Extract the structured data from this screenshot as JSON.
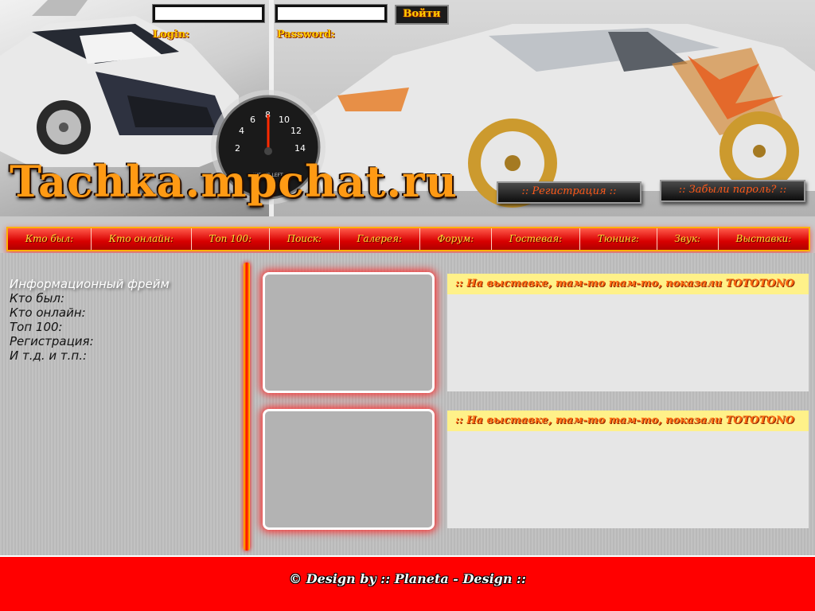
{
  "header": {
    "site_title": "Tachka.mpchat.ru",
    "login_label": "Login:",
    "password_label": "Password:",
    "login_value": "",
    "password_value": "",
    "submit_label": "Войти",
    "register_label": ":: Регистрация ::",
    "forgot_label": ":: Забыли пароль? ::",
    "gauge": {
      "ticks": [
        "2",
        "4",
        "6",
        "8",
        "10",
        "12",
        "14"
      ],
      "caption": "WEEKS LEFT"
    }
  },
  "nav": {
    "items": [
      "Кто был:",
      "Кто онлайн:",
      "Топ 100:",
      "Поиск:",
      "Галерея:",
      "Форум:",
      "Гостевая:",
      "Тюнинг:",
      "Звук:",
      "Выставки:"
    ]
  },
  "info_frame": {
    "title": "Информационный фрейм",
    "lines": [
      "Кто был:",
      "Кто онлайн:",
      "Топ 100:",
      "Регистрация:",
      "И т.д. и т.п.:"
    ]
  },
  "news": [
    {
      "headline": ":: На выставке, там-то там-то, показали ТОТОТОNO"
    },
    {
      "headline": ":: На выставке, там-то там-то, показали ТОТОТОNO"
    }
  ],
  "footer": {
    "text": "© Design by :: Planeta - Design ::"
  },
  "colors": {
    "accent_red": "#ff0000",
    "accent_gold": "#ffcc00",
    "panel_grey": "#e6e6e6",
    "headline_bg": "#fff189"
  }
}
